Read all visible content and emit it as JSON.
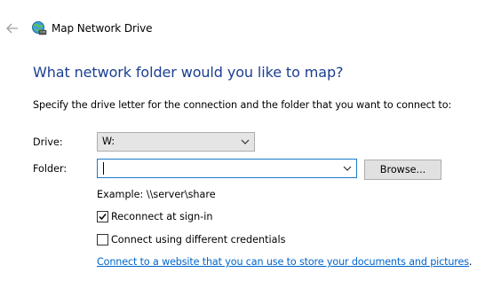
{
  "window": {
    "title": "Map Network Drive",
    "back_icon": "back-arrow-icon",
    "app_icon": "network-drive-icon"
  },
  "main": {
    "heading": "What network folder would you like to map?",
    "instructions": "Specify the drive letter for the connection and the folder that you want to connect to:"
  },
  "drive": {
    "label": "Drive:",
    "selected": "W:"
  },
  "folder": {
    "label": "Folder:",
    "value": "",
    "browse_label": "Browse...",
    "example": "Example: \\\\server\\share"
  },
  "options": {
    "reconnect": {
      "label": "Reconnect at sign-in",
      "checked": true
    },
    "credentials": {
      "label": "Connect using different credentials",
      "checked": false
    }
  },
  "link": {
    "text": "Connect to a website that you can use to store your documents and pictures",
    "suffix": "."
  },
  "colors": {
    "heading": "#1b3e93",
    "link": "#0066cc",
    "focus_border": "#1979ca"
  }
}
